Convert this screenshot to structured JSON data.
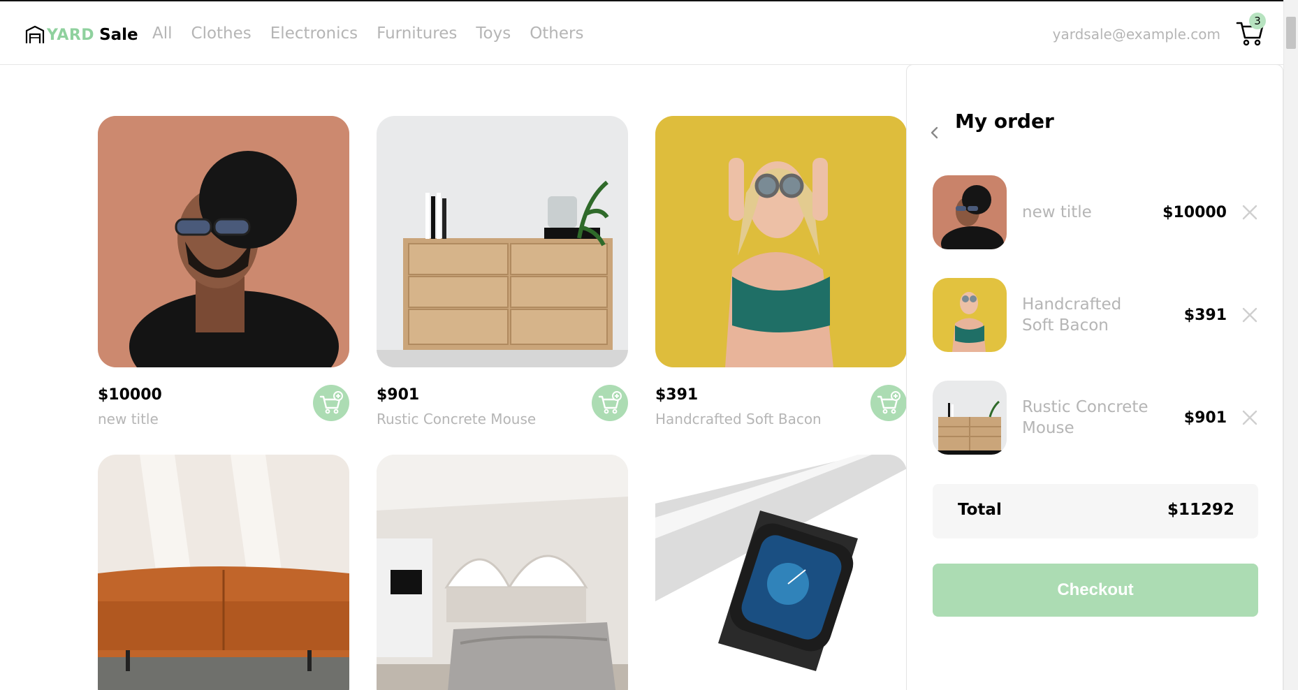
{
  "header": {
    "logo_yard": "YARD",
    "logo_sale": "Sale",
    "nav": [
      "All",
      "Clothes",
      "Electronics",
      "Furnitures",
      "Toys",
      "Others"
    ],
    "email": "yardsale@example.com",
    "cart_count": "3",
    "cart_icon": "shopping-cart-icon"
  },
  "products": [
    {
      "price": "$10000",
      "name": "new title",
      "image": "man-in-hat-sunglasses-photo"
    },
    {
      "price": "$901",
      "name": "Rustic Concrete Mouse",
      "image": "wooden-dresser-photo"
    },
    {
      "price": "$391",
      "name": "Handcrafted Soft Bacon",
      "image": "woman-yellow-wall-photo"
    },
    {
      "price": "",
      "name": "",
      "image": "orange-leather-sofa-photo"
    },
    {
      "price": "",
      "name": "",
      "image": "bedroom-interior-photo"
    },
    {
      "price": "",
      "name": "",
      "image": "smartwatch-photo"
    }
  ],
  "order": {
    "title": "My order",
    "items": [
      {
        "name": "new title",
        "price": "$10000"
      },
      {
        "name": "Handcrafted Soft Bacon",
        "price": "$391"
      },
      {
        "name": "Rustic Concrete Mouse",
        "price": "$901"
      }
    ],
    "total_label": "Total",
    "total_value": "$11292",
    "checkout_label": "Checkout"
  },
  "colors": {
    "accent_green": "#acdcb3",
    "logo_green": "#8fd19e",
    "muted_text": "#b5b5b5"
  }
}
